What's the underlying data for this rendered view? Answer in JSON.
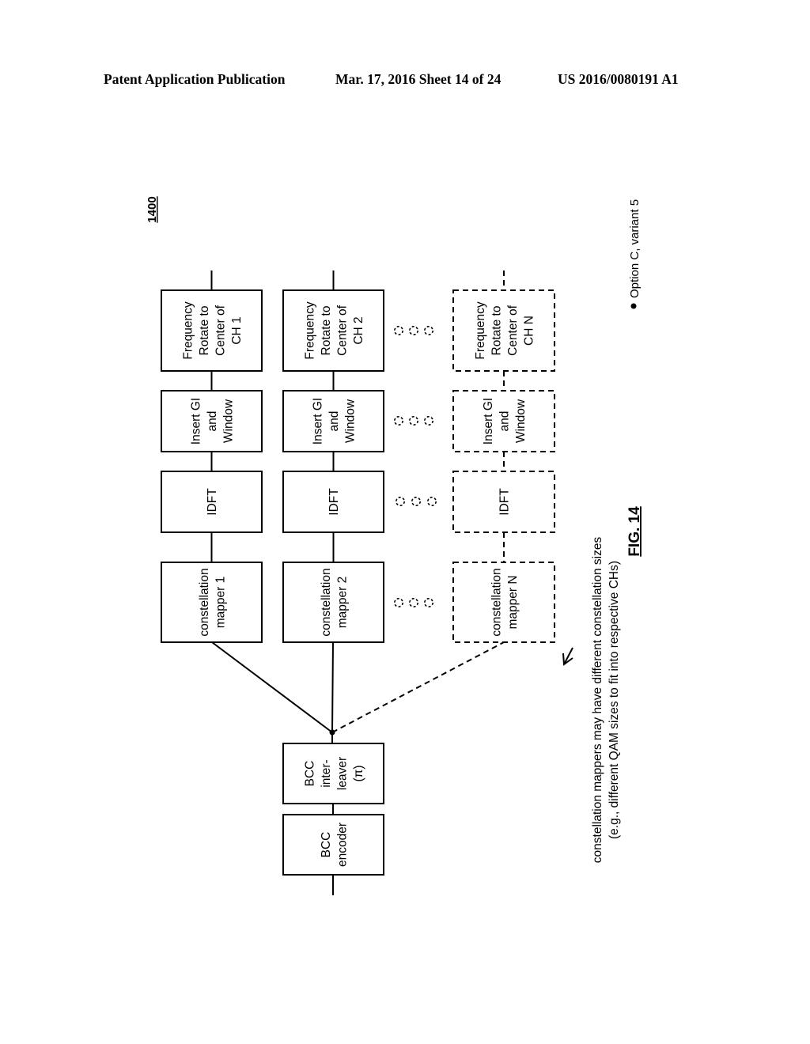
{
  "header": {
    "publication_type": "Patent Application Publication",
    "date_sheet": "Mar. 17, 2016  Sheet 14 of 24",
    "publication_number": "US 2016/0080191 A1"
  },
  "figure": {
    "reference_number": "1400",
    "caption": "FIG. 14",
    "option_note": "Option C, variant 5",
    "annotation_line1": "constellation mappers may have different constellation sizes",
    "annotation_line2": "(e.g., different QAM sizes to fit into respective CHs)"
  },
  "blocks": {
    "bcc_encoder": [
      "BCC",
      "encoder"
    ],
    "bcc_interleaver": [
      "BCC",
      "inter-",
      "leaver",
      "(π)"
    ],
    "chains": [
      {
        "id": "ch1",
        "style": "solid",
        "mapper": [
          "constellation",
          "mapper 1"
        ],
        "idft": [
          "IDFT"
        ],
        "gi": [
          "Insert GI",
          "and",
          "Window"
        ],
        "rotate": [
          "Frequency",
          "Rotate to",
          "Center of",
          "CH 1"
        ]
      },
      {
        "id": "ch2",
        "style": "solid",
        "mapper": [
          "constellation",
          "mapper 2"
        ],
        "idft": [
          "IDFT"
        ],
        "gi": [
          "Insert GI",
          "and",
          "Window"
        ],
        "rotate": [
          "Frequency",
          "Rotate to",
          "Center of",
          "CH 2"
        ]
      },
      {
        "id": "chN",
        "style": "dashed",
        "mapper": [
          "constellation",
          "mapper N"
        ],
        "idft": [
          "IDFT"
        ],
        "gi": [
          "Insert GI",
          "and",
          "Window"
        ],
        "rotate": [
          "Frequency",
          "Rotate to",
          "Center of",
          "CH N"
        ]
      }
    ],
    "ellipsis_symbol": "ooo"
  }
}
